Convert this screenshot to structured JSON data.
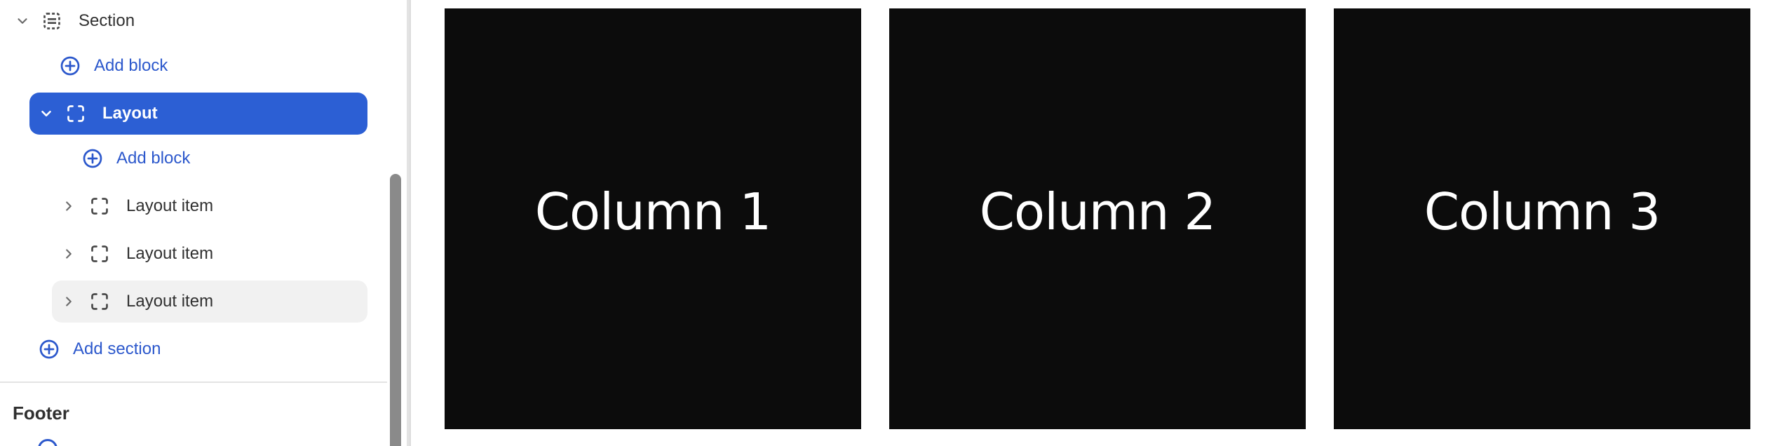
{
  "sidebar": {
    "section": {
      "label": "Section",
      "icon": "section-icon",
      "expanded": true
    },
    "section_add_block": {
      "label": "Add block",
      "icon": "plus-circle-icon"
    },
    "layout": {
      "label": "Layout",
      "icon": "layout-icon",
      "expanded": true,
      "selected": true
    },
    "layout_add_block": {
      "label": "Add block",
      "icon": "plus-circle-icon"
    },
    "layout_items": [
      {
        "label": "Layout item",
        "icon": "layout-item-icon",
        "expanded": false
      },
      {
        "label": "Layout item",
        "icon": "layout-item-icon",
        "expanded": false
      },
      {
        "label": "Layout item",
        "icon": "layout-item-icon",
        "expanded": false,
        "hovered": true
      }
    ],
    "add_section": {
      "label": "Add section",
      "icon": "plus-circle-icon"
    },
    "footer": {
      "title": "Footer"
    }
  },
  "canvas": {
    "columns": [
      {
        "label": "Column 1"
      },
      {
        "label": "Column 2"
      },
      {
        "label": "Column 3"
      }
    ]
  },
  "colors": {
    "accent": "#2c5fd4",
    "link": "#2c58cc",
    "column_bg": "#0c0c0c",
    "column_text": "#ffffff",
    "hover_bg": "#f1f1f1"
  }
}
